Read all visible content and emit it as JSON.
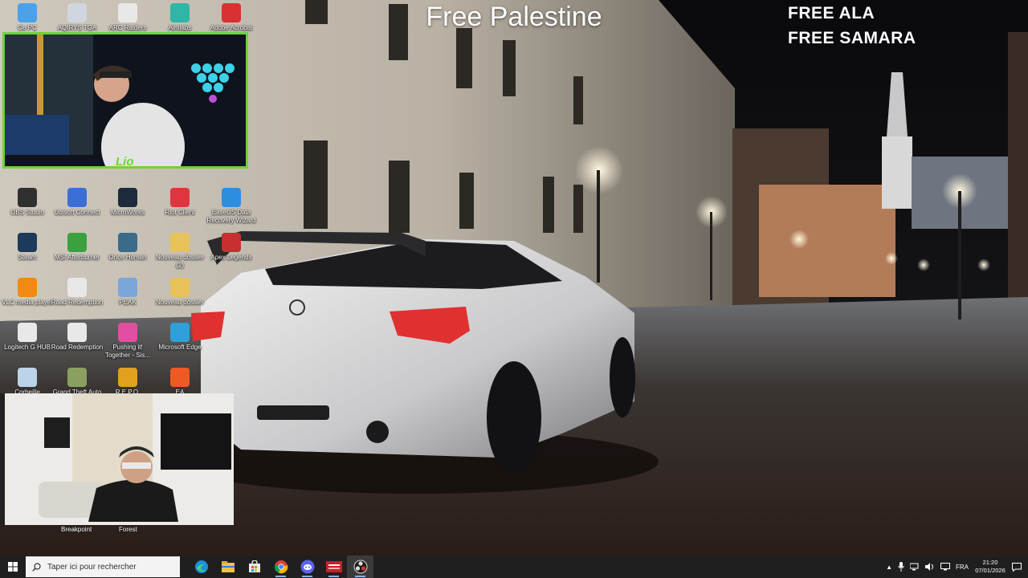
{
  "overlay": {
    "title": "Free Palestine",
    "free_line_1": "FREE ALA",
    "free_line_2": "FREE SAMARA"
  },
  "desktop": {
    "icons": [
      {
        "label": "Ce PC",
        "icon": "this-pc-icon",
        "color": "#4aa3e8"
      },
      {
        "label": "AQIRYS TGA Aloha",
        "icon": "aqirys-icon",
        "color": "#cfd6e0"
      },
      {
        "label": "ARC Raiders",
        "icon": "document-icon",
        "color": "#e8e8e8"
      },
      {
        "label": "Aimlabs",
        "icon": "aimlabs-icon",
        "color": "#2fb6a6"
      },
      {
        "label": "Adobe Acrobat",
        "icon": "acrobat-icon",
        "color": "#d93131"
      },
      {
        "label": "OBS Studio",
        "icon": "obs-icon",
        "color": "#303030"
      },
      {
        "label": "Ubisoft Connect",
        "icon": "ubisoft-icon",
        "color": "#3b6fd6"
      },
      {
        "label": "MicroWorks",
        "icon": "microworks-icon",
        "color": "#1c2a3c"
      },
      {
        "label": "Riot Client",
        "icon": "riot-icon",
        "color": "#e0353e"
      },
      {
        "label": "EaseUS Data Recovery Wizard",
        "icon": "easeus-icon",
        "color": "#2d8ee0"
      },
      {
        "label": "Steam",
        "icon": "steam-icon",
        "color": "#1b3a5c"
      },
      {
        "label": "MSI Afterburner",
        "icon": "afterburner-icon",
        "color": "#3aa040"
      },
      {
        "label": "Once Human",
        "icon": "once-human-icon",
        "color": "#3a6b8a"
      },
      {
        "label": "Nouveau dossier (2)",
        "icon": "folder-icon",
        "color": "#e8c25a"
      },
      {
        "label": "Apex Legends",
        "icon": "apex-icon",
        "color": "#c7302f"
      },
      {
        "label": "VLC media player",
        "icon": "vlc-icon",
        "color": "#f08a12"
      },
      {
        "label": "Road Redemption",
        "icon": "road-redemption-icon",
        "color": "#e8e8e8"
      },
      {
        "label": "PEAK",
        "icon": "peak-icon",
        "color": "#7aa7d8"
      },
      {
        "label": "Nouveau dossier",
        "icon": "folder-icon",
        "color": "#e8c25a"
      },
      {
        "label": "Logitech G HUB",
        "icon": "logitech-icon",
        "color": "#e8e8e8"
      },
      {
        "label": "Road Redemption",
        "icon": "road-redemption-icon",
        "color": "#e8e8e8"
      },
      {
        "label": "Pushing it! Together - Sis...",
        "icon": "pushing-it-icon",
        "color": "#e04fa0"
      },
      {
        "label": "Microsoft Edge",
        "icon": "edge-icon",
        "color": "#2fa0d8"
      },
      {
        "label": "Corbeille",
        "icon": "recycle-bin-icon",
        "color": "#bcd4ea"
      },
      {
        "label": "Grand Theft Auto",
        "icon": "gta-icon",
        "color": "#8aa060"
      },
      {
        "label": "R.E.P.O.",
        "icon": "repo-icon",
        "color": "#e0a020"
      },
      {
        "label": "EA",
        "icon": "ea-icon",
        "color": "#ef5a24"
      }
    ]
  },
  "webcams": {
    "top_tag": "Lio",
    "bottom_left_label": "Breakpoint",
    "bottom_right_label": "Forest"
  },
  "taskbar": {
    "search_placeholder": "Taper ici pour rechercher",
    "apps": [
      "edge-icon",
      "file-explorer-icon",
      "store-icon",
      "chrome-icon",
      "discord-icon",
      "recording-app-icon",
      "obs-icon"
    ],
    "tray": {
      "language": "FRA",
      "time": "21:20",
      "date": "07/01/2026"
    }
  },
  "colors": {
    "cam_border": "#6ad43a",
    "taskbar": "#1f1f1f"
  }
}
